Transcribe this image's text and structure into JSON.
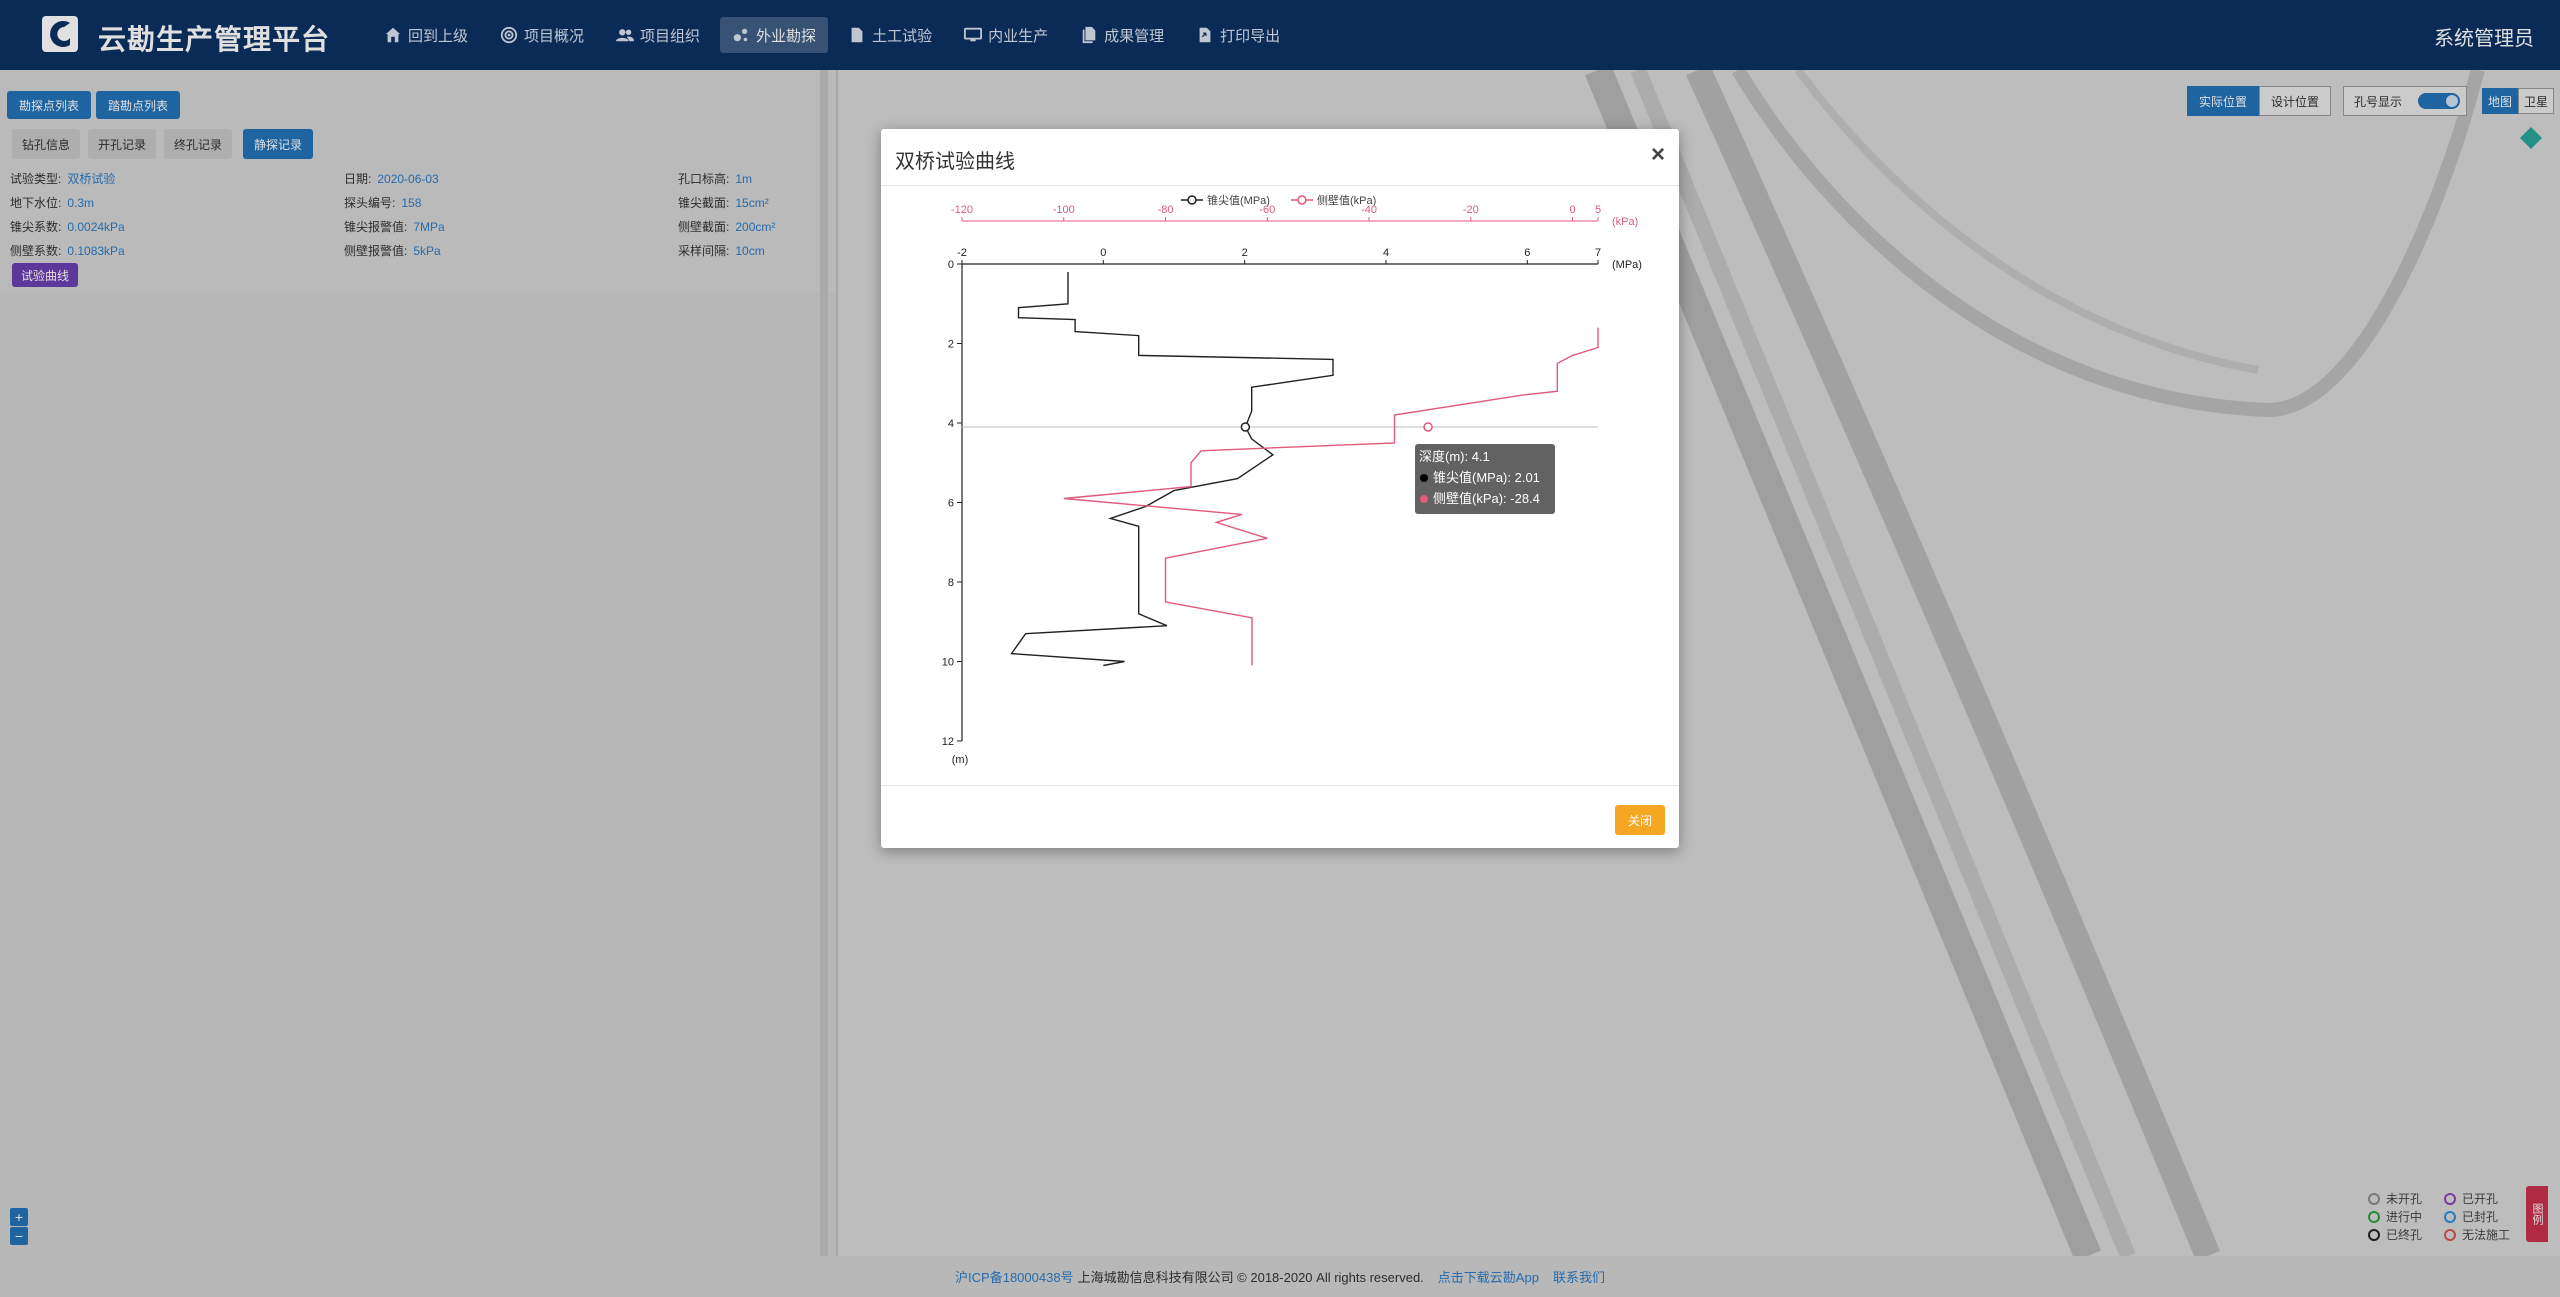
{
  "header": {
    "app_title": "云勘生产管理平台",
    "nav": [
      {
        "label": "回到上级",
        "icon": "home-icon"
      },
      {
        "label": "项目概况",
        "icon": "target-icon"
      },
      {
        "label": "项目组织",
        "icon": "users-icon"
      },
      {
        "label": "外业勘探",
        "icon": "drill-icon",
        "active": true
      },
      {
        "label": "土工试验",
        "icon": "document-icon"
      },
      {
        "label": "内业生产",
        "icon": "monitor-icon"
      },
      {
        "label": "成果管理",
        "icon": "files-icon"
      },
      {
        "label": "打印导出",
        "icon": "export-icon"
      }
    ],
    "user": "系统管理员"
  },
  "left_panel": {
    "list_buttons": [
      "勘探点列表",
      "踏勘点列表"
    ],
    "tabs": [
      "钻孔信息",
      "开孔记录",
      "终孔记录",
      "静探记录"
    ],
    "active_tab": "静探记录",
    "info": [
      {
        "k": "试验类型:",
        "v": "双桥试验"
      },
      {
        "k": "日期:",
        "v": "2020-06-03"
      },
      {
        "k": "孔口标高:",
        "v": "1m"
      },
      {
        "k": "地下水位:",
        "v": "0.3m"
      },
      {
        "k": "探头编号:",
        "v": "158"
      },
      {
        "k": "锥尖截面:",
        "v": "15cm²"
      },
      {
        "k": "锥尖系数:",
        "v": "0.0024kPa"
      },
      {
        "k": "锥尖报警值:",
        "v": "7MPa"
      },
      {
        "k": "侧壁截面:",
        "v": "200cm²"
      },
      {
        "k": "侧壁系数:",
        "v": "0.1083kPa"
      },
      {
        "k": "侧壁报警值:",
        "v": "5kPa"
      },
      {
        "k": "采样间隔:",
        "v": "10cm"
      }
    ],
    "curve_button": "试验曲线"
  },
  "map": {
    "position_buttons": [
      "实际位置",
      "设计位置"
    ],
    "hole_display_label": "孔号显示",
    "basemap_buttons": [
      "地图",
      "卫星"
    ],
    "legend": [
      {
        "label": "未开孔",
        "color": "#8a8a8a"
      },
      {
        "label": "已开孔",
        "color": "#8e44ad"
      },
      {
        "label": "进行中",
        "color": "#2e9e3e"
      },
      {
        "label": "已封孔",
        "color": "#2a8fd6"
      },
      {
        "label": "已终孔",
        "color": "#222222"
      },
      {
        "label": "无法施工",
        "color": "#d9534f"
      }
    ],
    "side_tab": "图例",
    "zoom_in": "+",
    "zoom_out": "−"
  },
  "footer": {
    "icp": "沪ICP备18000438号",
    "company": "上海城勘信息科技有限公司 © 2018-2020 All rights reserved.",
    "download": "点击下载云勘App",
    "contact": "联系我们"
  },
  "modal": {
    "title": "双桥试验曲线",
    "close_label": "关闭",
    "tooltip": {
      "title": "深度(m): 4.1",
      "line1": "锥尖值(MPa): 2.01",
      "line2": "侧壁值(kPa): -28.4"
    }
  },
  "chart_data": {
    "type": "line",
    "title": "",
    "legend": [
      "锥尖值(MPa)",
      "侧壁值(kPa)"
    ],
    "legend_position": "top-center",
    "y_axis": {
      "label": "(m)",
      "range": [
        0,
        12
      ],
      "ticks": [
        0,
        2,
        4,
        6,
        8,
        10,
        12
      ],
      "inverted": true
    },
    "x_axis_bottom": {
      "label": "(MPa)",
      "range": [
        -2,
        7
      ],
      "ticks": [
        -2,
        0,
        2,
        4,
        6,
        7
      ]
    },
    "x_axis_top": {
      "label": "(kPa)",
      "range": [
        -120,
        5
      ],
      "ticks": [
        -120,
        -100,
        -80,
        -60,
        -40,
        -20,
        0,
        5
      ]
    },
    "series": [
      {
        "name": "锥尖值(MPa)",
        "axis": "bottom",
        "color": "#222222",
        "points": [
          [
            -0.5,
            0.2
          ],
          [
            -0.5,
            1.0
          ],
          [
            -1.2,
            1.1
          ],
          [
            -1.2,
            1.35
          ],
          [
            -0.4,
            1.4
          ],
          [
            -0.4,
            1.7
          ],
          [
            0.5,
            1.8
          ],
          [
            0.5,
            2.3
          ],
          [
            3.25,
            2.4
          ],
          [
            3.25,
            2.8
          ],
          [
            2.1,
            3.1
          ],
          [
            2.1,
            3.3
          ],
          [
            2.1,
            3.7
          ],
          [
            2.01,
            4.1
          ],
          [
            2.1,
            4.4
          ],
          [
            2.4,
            4.8
          ],
          [
            1.9,
            5.4
          ],
          [
            1.0,
            5.7
          ],
          [
            0.6,
            6.1
          ],
          [
            0.1,
            6.4
          ],
          [
            0.5,
            6.6
          ],
          [
            0.5,
            8.8
          ],
          [
            0.9,
            9.1
          ],
          [
            -1.1,
            9.3
          ],
          [
            -1.3,
            9.8
          ],
          [
            0.3,
            10.0
          ],
          [
            0.0,
            10.1
          ]
        ]
      },
      {
        "name": "侧壁值(kPa)",
        "axis": "top",
        "color": "#e05a7a",
        "points": [
          [
            5,
            1.6
          ],
          [
            5,
            2.1
          ],
          [
            0,
            2.3
          ],
          [
            -3,
            2.5
          ],
          [
            -3,
            3.2
          ],
          [
            -10,
            3.3
          ],
          [
            -35,
            3.8
          ],
          [
            -35,
            4.3
          ],
          [
            -35,
            4.5
          ],
          [
            -73,
            4.7
          ],
          [
            -75,
            5.0
          ],
          [
            -75,
            5.6
          ],
          [
            -100,
            5.9
          ],
          [
            -65,
            6.3
          ],
          [
            -70,
            6.5
          ],
          [
            -60,
            6.9
          ],
          [
            -80,
            7.4
          ],
          [
            -80,
            8.5
          ],
          [
            -63,
            8.9
          ],
          [
            -63,
            10.1
          ]
        ]
      }
    ],
    "crosshair_depth": 4.1,
    "highlight": {
      "depth": 4.1,
      "cone_tip": 2.01,
      "side_wall": -28.4
    }
  }
}
